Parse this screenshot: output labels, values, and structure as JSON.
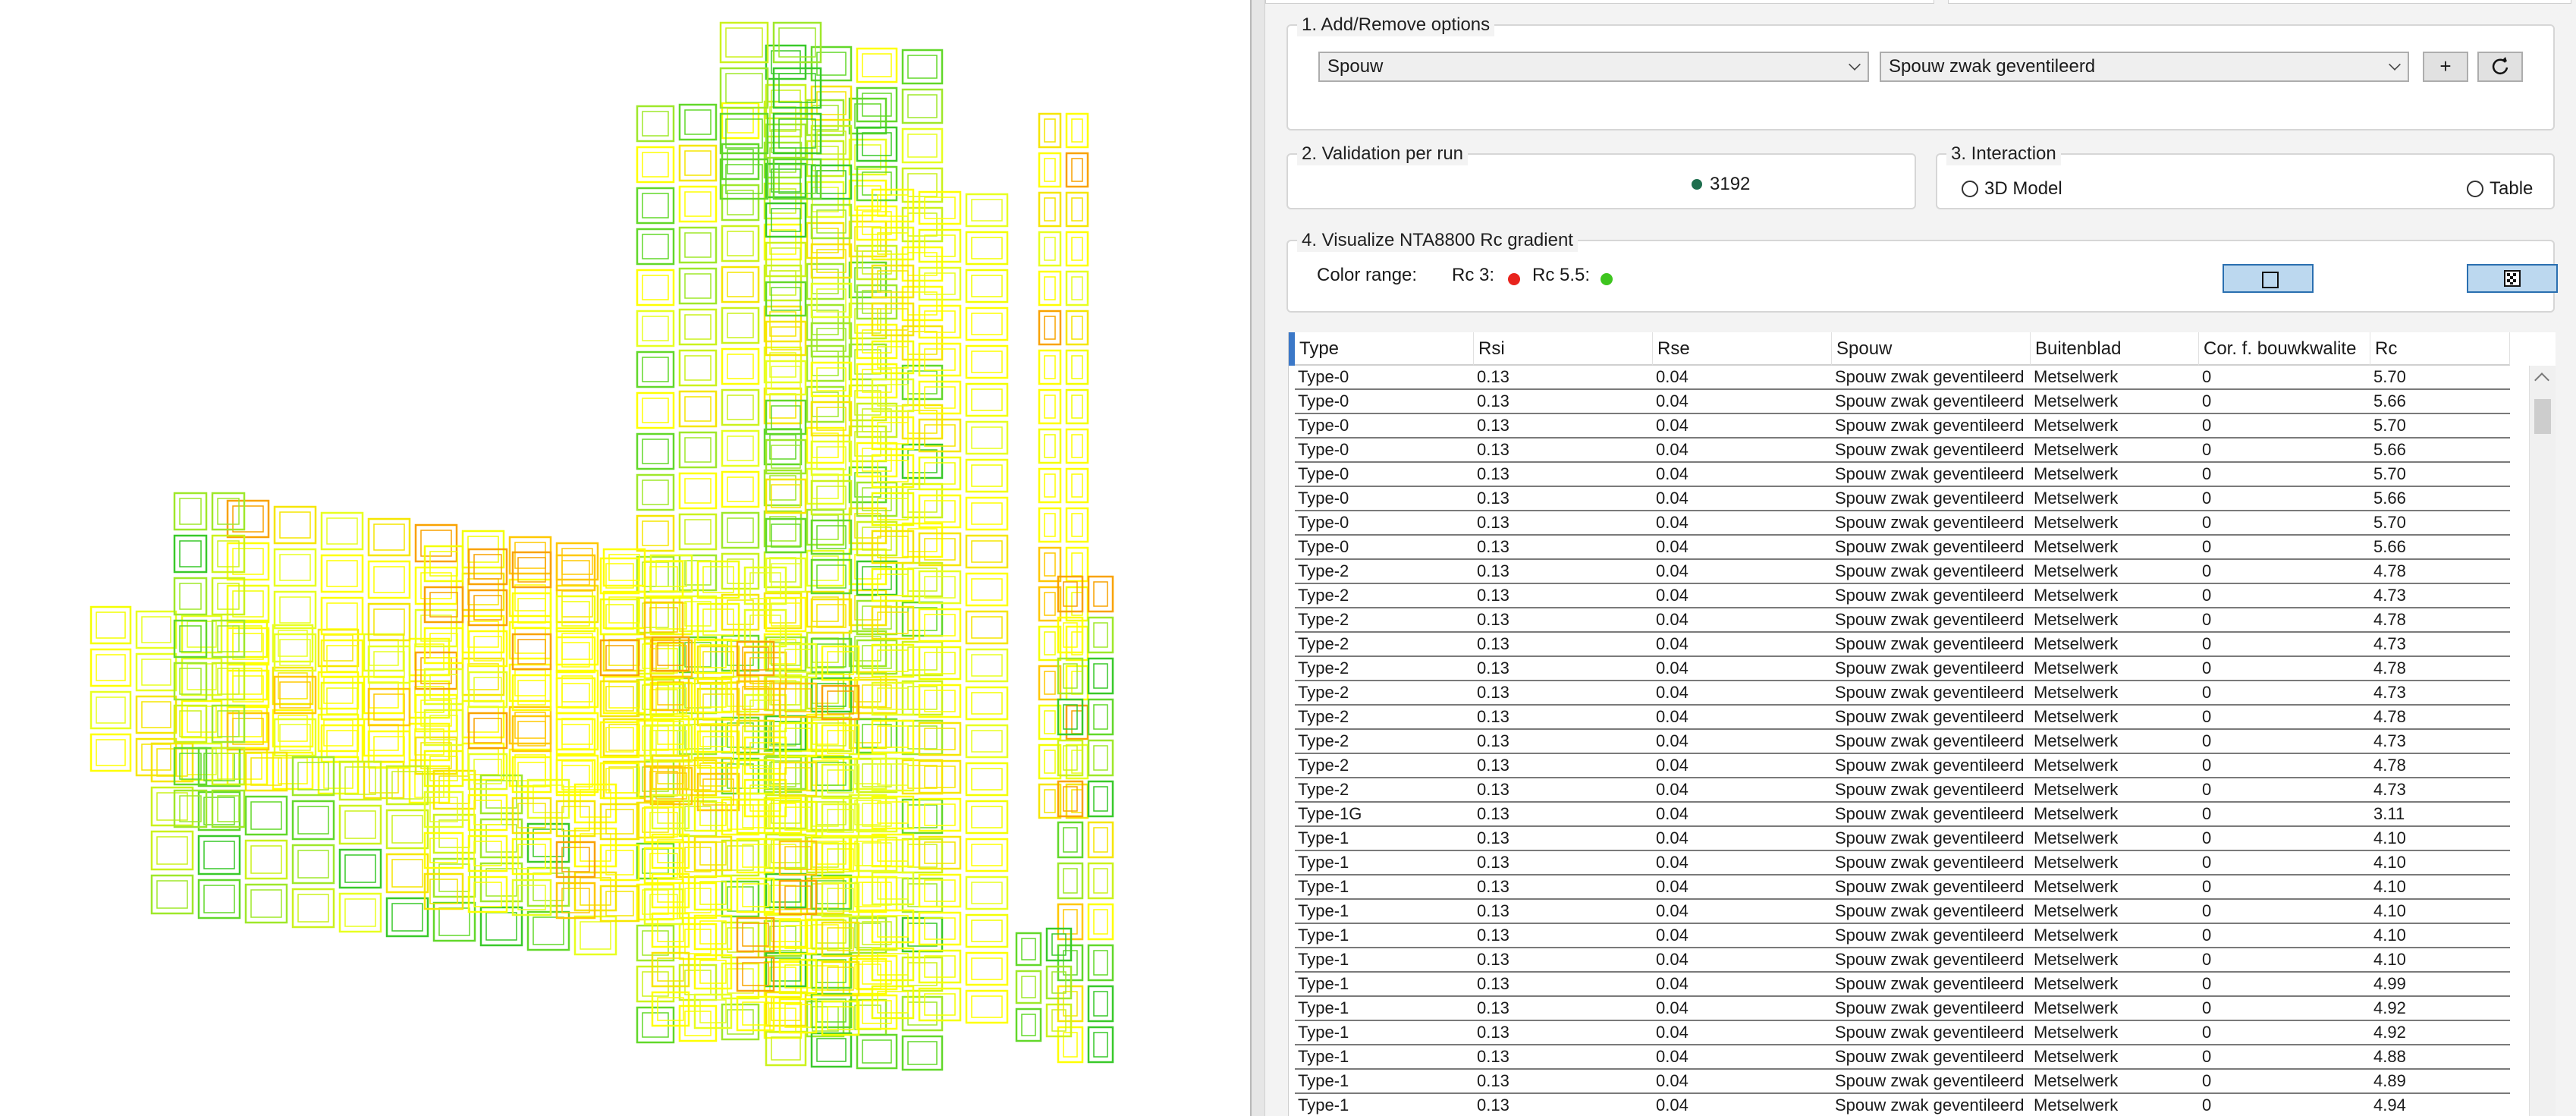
{
  "colors": {
    "low": "#e8231d",
    "high": "#3ec51f",
    "accent": "#3b78c8",
    "validation_dot": "#1e6e4e"
  },
  "add_remove": {
    "title": "1. Add/Remove options",
    "category": "Spouw",
    "option": "Spouw zwak geventileerd",
    "add_label": "+",
    "refresh_icon": "refresh-icon"
  },
  "validation": {
    "title": "2. Validation per run",
    "count": "3192"
  },
  "interaction": {
    "title": "3. Interaction",
    "model_label": "3D Model",
    "table_label": "Table"
  },
  "visualize": {
    "title": "4. Visualize NTA8800 Rc gradient",
    "range_label": "Color range:",
    "low_label": "Rc 3:",
    "high_label": "Rc 5.5:"
  },
  "table": {
    "columns": [
      "Type",
      "Rsi",
      "Rse",
      "Spouw",
      "Buitenblad",
      "Cor. f. bouwkwalite",
      "Rc"
    ],
    "rows": [
      [
        "Type-0",
        "0.13",
        "0.04",
        "Spouw zwak geventileerd",
        "Metselwerk",
        "0",
        "5.70"
      ],
      [
        "Type-0",
        "0.13",
        "0.04",
        "Spouw zwak geventileerd",
        "Metselwerk",
        "0",
        "5.66"
      ],
      [
        "Type-0",
        "0.13",
        "0.04",
        "Spouw zwak geventileerd",
        "Metselwerk",
        "0",
        "5.70"
      ],
      [
        "Type-0",
        "0.13",
        "0.04",
        "Spouw zwak geventileerd",
        "Metselwerk",
        "0",
        "5.66"
      ],
      [
        "Type-0",
        "0.13",
        "0.04",
        "Spouw zwak geventileerd",
        "Metselwerk",
        "0",
        "5.70"
      ],
      [
        "Type-0",
        "0.13",
        "0.04",
        "Spouw zwak geventileerd",
        "Metselwerk",
        "0",
        "5.66"
      ],
      [
        "Type-0",
        "0.13",
        "0.04",
        "Spouw zwak geventileerd",
        "Metselwerk",
        "0",
        "5.70"
      ],
      [
        "Type-0",
        "0.13",
        "0.04",
        "Spouw zwak geventileerd",
        "Metselwerk",
        "0",
        "5.66"
      ],
      [
        "Type-2",
        "0.13",
        "0.04",
        "Spouw zwak geventileerd",
        "Metselwerk",
        "0",
        "4.78"
      ],
      [
        "Type-2",
        "0.13",
        "0.04",
        "Spouw zwak geventileerd",
        "Metselwerk",
        "0",
        "4.73"
      ],
      [
        "Type-2",
        "0.13",
        "0.04",
        "Spouw zwak geventileerd",
        "Metselwerk",
        "0",
        "4.78"
      ],
      [
        "Type-2",
        "0.13",
        "0.04",
        "Spouw zwak geventileerd",
        "Metselwerk",
        "0",
        "4.73"
      ],
      [
        "Type-2",
        "0.13",
        "0.04",
        "Spouw zwak geventileerd",
        "Metselwerk",
        "0",
        "4.78"
      ],
      [
        "Type-2",
        "0.13",
        "0.04",
        "Spouw zwak geventileerd",
        "Metselwerk",
        "0",
        "4.73"
      ],
      [
        "Type-2",
        "0.13",
        "0.04",
        "Spouw zwak geventileerd",
        "Metselwerk",
        "0",
        "4.78"
      ],
      [
        "Type-2",
        "0.13",
        "0.04",
        "Spouw zwak geventileerd",
        "Metselwerk",
        "0",
        "4.73"
      ],
      [
        "Type-2",
        "0.13",
        "0.04",
        "Spouw zwak geventileerd",
        "Metselwerk",
        "0",
        "4.78"
      ],
      [
        "Type-2",
        "0.13",
        "0.04",
        "Spouw zwak geventileerd",
        "Metselwerk",
        "0",
        "4.73"
      ],
      [
        "Type-1G",
        "0.13",
        "0.04",
        "Spouw zwak geventileerd",
        "Metselwerk",
        "0",
        "3.11"
      ],
      [
        "Type-1",
        "0.13",
        "0.04",
        "Spouw zwak geventileerd",
        "Metselwerk",
        "0",
        "4.10"
      ],
      [
        "Type-1",
        "0.13",
        "0.04",
        "Spouw zwak geventileerd",
        "Metselwerk",
        "0",
        "4.10"
      ],
      [
        "Type-1",
        "0.13",
        "0.04",
        "Spouw zwak geventileerd",
        "Metselwerk",
        "0",
        "4.10"
      ],
      [
        "Type-1",
        "0.13",
        "0.04",
        "Spouw zwak geventileerd",
        "Metselwerk",
        "0",
        "4.10"
      ],
      [
        "Type-1",
        "0.13",
        "0.04",
        "Spouw zwak geventileerd",
        "Metselwerk",
        "0",
        "4.10"
      ],
      [
        "Type-1",
        "0.13",
        "0.04",
        "Spouw zwak geventileerd",
        "Metselwerk",
        "0",
        "4.10"
      ],
      [
        "Type-1",
        "0.13",
        "0.04",
        "Spouw zwak geventileerd",
        "Metselwerk",
        "0",
        "4.99"
      ],
      [
        "Type-1",
        "0.13",
        "0.04",
        "Spouw zwak geventileerd",
        "Metselwerk",
        "0",
        "4.92"
      ],
      [
        "Type-1",
        "0.13",
        "0.04",
        "Spouw zwak geventileerd",
        "Metselwerk",
        "0",
        "4.92"
      ],
      [
        "Type-1",
        "0.13",
        "0.04",
        "Spouw zwak geventileerd",
        "Metselwerk",
        "0",
        "4.88"
      ],
      [
        "Type-1",
        "0.13",
        "0.04",
        "Spouw zwak geventileerd",
        "Metselwerk",
        "0",
        "4.89"
      ],
      [
        "Type-1",
        "0.13",
        "0.04",
        "Spouw zwak geventileerd",
        "Metselwerk",
        "0",
        "4.94"
      ]
    ]
  }
}
